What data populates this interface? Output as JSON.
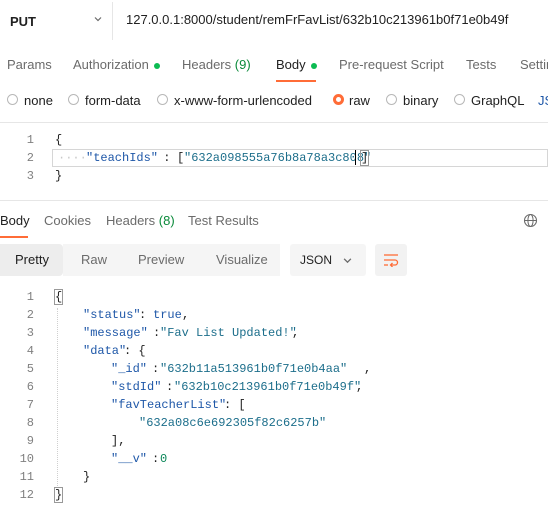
{
  "request": {
    "method": "PUT",
    "url": "127.0.0.1:8000/student/remFrFavList/632b10c213961b0f71e0b49f"
  },
  "request_tabs": [
    {
      "label": "Params"
    },
    {
      "label": "Authorization"
    },
    {
      "label": "Headers",
      "count": "(9)"
    },
    {
      "label": "Body"
    },
    {
      "label": "Pre-request Script"
    },
    {
      "label": "Tests"
    },
    {
      "label": "Settin"
    }
  ],
  "body_types": [
    {
      "label": "none"
    },
    {
      "label": "form-data"
    },
    {
      "label": "x-www-form-urlencoded"
    },
    {
      "label": "raw"
    },
    {
      "label": "binary"
    },
    {
      "label": "GraphQL"
    },
    {
      "label": "JS"
    }
  ],
  "request_body": {
    "line_numbers": [
      "1",
      "2",
      "3"
    ],
    "open": "{",
    "key": "\"teachIds\"",
    "colon": " : ",
    "bracket_open": "[",
    "value": "\"632a098555a76b8a78a3c808\"",
    "bracket_close": "]",
    "close": "}"
  },
  "response_tabs": [
    {
      "label": "Body"
    },
    {
      "label": "Cookies"
    },
    {
      "label": "Headers",
      "count": "(8)"
    },
    {
      "label": "Test Results"
    }
  ],
  "view_modes": [
    {
      "label": "Pretty"
    },
    {
      "label": "Raw"
    },
    {
      "label": "Preview"
    },
    {
      "label": "Visualize"
    }
  ],
  "format_select": {
    "value": "JSON"
  },
  "response_body": {
    "line_numbers": [
      "1",
      "2",
      "3",
      "4",
      "5",
      "6",
      "7",
      "8",
      "9",
      "10",
      "11",
      "12"
    ],
    "l1": "{",
    "status_key": "\"status\"",
    "status_val": "true",
    "message_key": "\"message\"",
    "message_val": "\"Fav List Updated!\"",
    "data_key": "\"data\"",
    "id_key": "\"_id\"",
    "id_val": "\"632b11a513961b0f71e0b4aa\"",
    "stdid_key": "\"stdId\"",
    "stdid_val": "\"632b10c213961b0f71e0b49f\"",
    "fav_key": "\"favTeacherList\"",
    "fav_item": "\"632a08c6e692305f82c6257b\"",
    "v_key": "\"__v\"",
    "v_val": "0",
    "l12": "}"
  },
  "colors": {
    "accent": "#ff6c37",
    "active_dot": "#0cbb52",
    "json_key": "#1e57a8",
    "json_string": "#1c6e8b"
  }
}
